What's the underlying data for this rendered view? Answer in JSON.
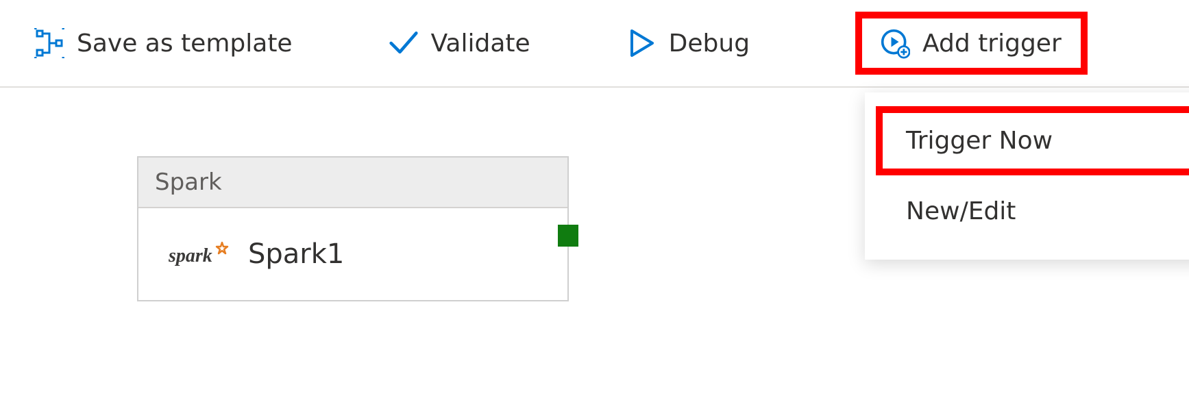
{
  "toolbar": {
    "save_template_label": "Save as template",
    "validate_label": "Validate",
    "debug_label": "Debug",
    "add_trigger_label": "Add trigger"
  },
  "trigger_menu": {
    "trigger_now_label": "Trigger Now",
    "new_edit_label": "New/Edit"
  },
  "activity": {
    "type_label": "Spark",
    "name": "Spark1"
  },
  "colors": {
    "accent_blue": "#0078d4",
    "highlight_red": "#ff0000",
    "connector_green": "#107c10",
    "spark_star": "#e67e22"
  },
  "icons": {
    "save_template": "save-template-icon",
    "validate": "checkmark-icon",
    "debug": "play-outline-icon",
    "add_trigger": "clock-plus-icon",
    "spark": "spark-logo-icon"
  }
}
